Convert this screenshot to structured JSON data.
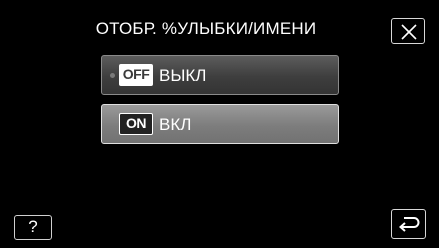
{
  "header": {
    "title": "ОТОБР. %УЛЫБКИ/ИМЕНИ",
    "close_icon": "close-icon"
  },
  "options": [
    {
      "badge": "OFF",
      "label": "ВЫКЛ",
      "selected": true
    },
    {
      "badge": "ON",
      "label": "ВКЛ",
      "selected": false
    }
  ],
  "footer": {
    "help_label": "?",
    "back_icon": "return-arrow-icon"
  },
  "colors": {
    "background": "#000000",
    "selected_option": "#4a4a4a",
    "option": "#858585",
    "text": "#ffffff"
  }
}
